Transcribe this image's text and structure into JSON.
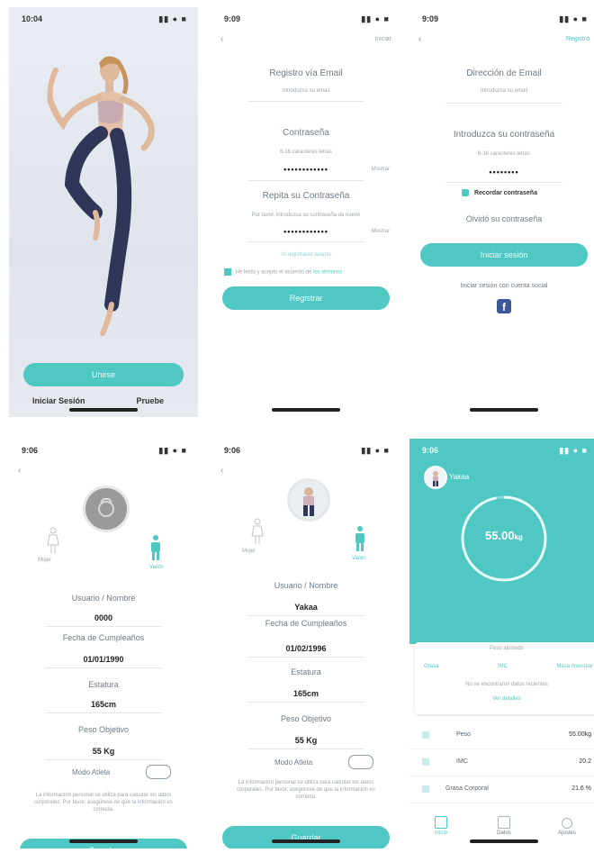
{
  "status_times": [
    "10:04",
    "9:09",
    "9:09",
    "9:06",
    "9:06",
    "9:06"
  ],
  "status_icons": "▮▮ ● ■",
  "screen1": {
    "primary_button": "Unirse",
    "login_link": "Iniciar Sesión",
    "skip_link": "Pruebe"
  },
  "screen2": {
    "top_link": "Iniciar",
    "email_title": "Registro vía Email",
    "email_placeholder": "Introduzca su email",
    "password_title": "Contraseña",
    "password_hint": "6-16 caracteres letras",
    "password_value": "••••••••••••",
    "confirm_title": "Repita su Contraseña",
    "confirm_hint": "Por favor, introduzca su contraseña de nuevo",
    "confirm_value": "••••••••••••",
    "show_pw": "Mostrar",
    "link_text": "Al registrarse acepta",
    "terms_text": "He leído y acepto el acuerdo de",
    "terms_link": "los términos",
    "register_button": "Registrar"
  },
  "screen3": {
    "top_link": "Registro",
    "email_title": "Dirección de Email",
    "email_placeholder": "Introduzca su email",
    "password_title": "Introduzca su contraseña",
    "password_hint": "6-16 caracteres letras",
    "password_value": "••••••••",
    "remember": "Recordar contraseña",
    "forgot": "Olvidó su contraseña",
    "login_button": "Iniciar sesión",
    "social_text": "Iniciar sesión con cuenta social"
  },
  "profile": {
    "female": "Mujer",
    "male": "Varón",
    "user_label": "Usuario / Nombre",
    "dob_label": "Fecha de Cumpleaños",
    "height_label": "Estatura",
    "target_label": "Peso Objetivo",
    "athlete_label": "Modo Atleta",
    "note": "La información personal se utiliza para calcular los datos corporales. Por favor, asegúrese de que la información es correcta.",
    "save_button": "Guardar"
  },
  "screen4": {
    "user": "0000",
    "dob": "01/01/1990",
    "height": "165cm",
    "target": "55 Kg"
  },
  "screen5": {
    "user": "Yakaa",
    "dob": "01/02/1996",
    "height": "165cm",
    "target": "55 Kg"
  },
  "screen6": {
    "user_name": "Yakaa",
    "ring_value": "55.00",
    "ring_unit": "kg",
    "card_title": "Peso ajustado",
    "stats": [
      "Grasa",
      "IMC",
      "Masa muscular"
    ],
    "card_note": "No se encontraron datos recientes",
    "card_link": "Ver detalles",
    "rows": [
      {
        "label": "Peso",
        "value": "55.00kg"
      },
      {
        "label": "IMC",
        "value": "20.2"
      },
      {
        "label": "Grasa Corporal",
        "value": "21.6 %"
      }
    ],
    "nav": [
      "Inicio",
      "Datos",
      "Ajustes"
    ]
  },
  "colors": {
    "accent": "#4fc7c3",
    "text": "#5a6670"
  }
}
